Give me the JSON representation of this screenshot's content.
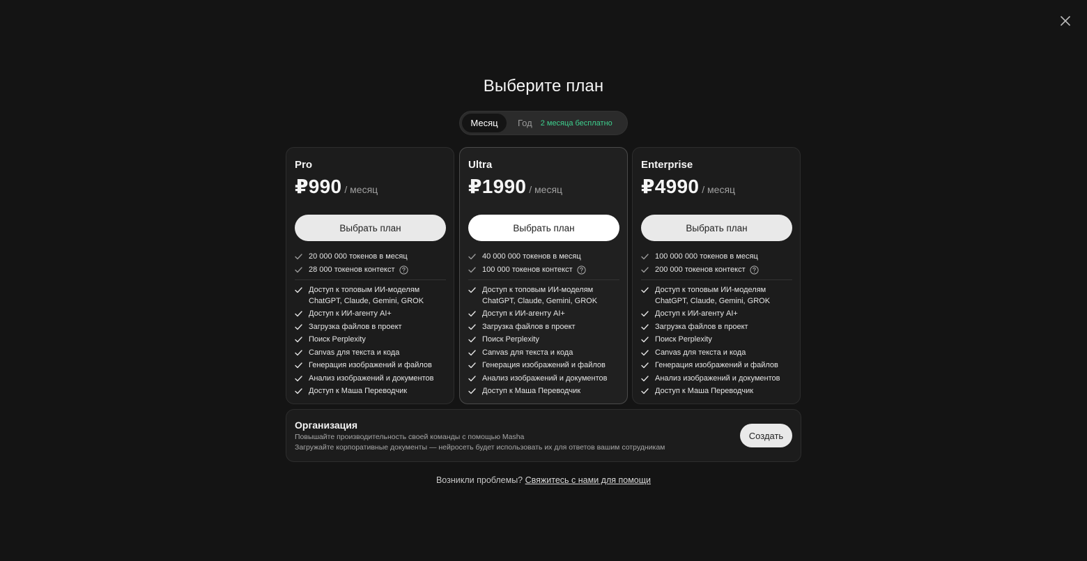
{
  "modal": {
    "title": "Выберите план",
    "close_icon": "close-icon"
  },
  "billing_toggle": {
    "month_label": "Месяц",
    "year_label": "Год",
    "year_badge": "2 месяца бесплатно",
    "selected": "Месяц",
    "badge_color": "#3ecf8e"
  },
  "plans": [
    {
      "name": "Pro",
      "price": "₽990",
      "period": "/ месяц",
      "button_label": "Выбрать план",
      "quota": [
        "20 000 000 токенов в месяц",
        "28 000 токенов контекст"
      ],
      "features": [
        "Доступ к топовым ИИ-моделям\nChatGPT, Claude, Gemini, GROK",
        "Доступ к ИИ-агенту AI+",
        "Загрузка файлов в проект",
        "Поиск Perplexity",
        "Canvas для текста и кода",
        "Генерация изображений и файлов",
        "Анализ изображений и документов",
        "Доступ к Маша Переводчик"
      ]
    },
    {
      "name": "Ultra",
      "price": "₽1990",
      "period": "/ месяц",
      "button_label": "Выбрать план",
      "quota": [
        "40 000 000 токенов в месяц",
        "100 000 токенов контекст"
      ],
      "features": [
        "Доступ к топовым ИИ-моделям\nChatGPT, Claude, Gemini, GROK",
        "Доступ к ИИ-агенту AI+",
        "Загрузка файлов в проект",
        "Поиск Perplexity",
        "Canvas для текста и кода",
        "Генерация изображений и файлов",
        "Анализ изображений и документов",
        "Доступ к Маша Переводчик"
      ]
    },
    {
      "name": "Enterprise",
      "price": "₽4990",
      "period": "/ месяц",
      "button_label": "Выбрать план",
      "quota": [
        "100 000 000 токенов в месяц",
        "200 000 токенов контекст"
      ],
      "features": [
        "Доступ к топовым ИИ-моделям\nChatGPT, Claude, Gemini, GROK",
        "Доступ к ИИ-агенту AI+",
        "Загрузка файлов в проект",
        "Поиск Perplexity",
        "Canvas для текста и кода",
        "Генерация изображений и файлов",
        "Анализ изображений и документов",
        "Доступ к Маша Переводчик"
      ]
    }
  ],
  "organization": {
    "title": "Организация",
    "line1": "Повышайте производительность своей команды с помощью Masha",
    "line2": "Загружайте корпоративные документы — нейросеть будет использовать их для ответов вашим сотрудникам",
    "button_label": "Создать"
  },
  "footer": {
    "prefix": "Возникли проблемы?",
    "link": "Свяжитесь с нами для помощи"
  }
}
